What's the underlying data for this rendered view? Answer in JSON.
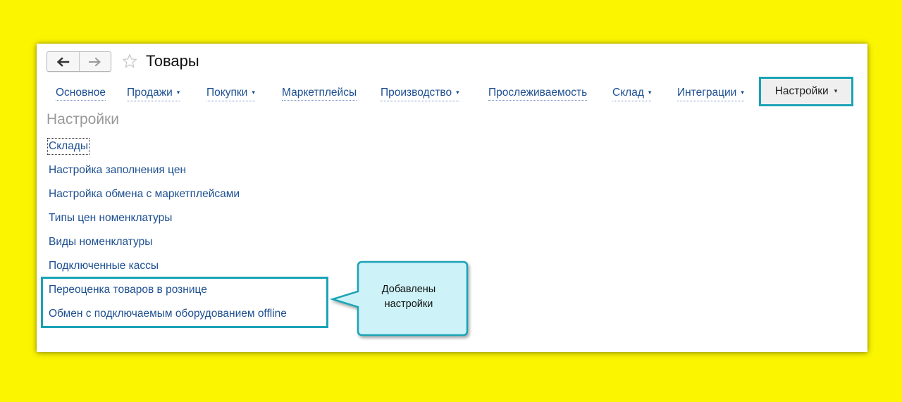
{
  "colors": {
    "background": "#fbf500",
    "link": "#1d4f91",
    "highlight": "#1aa3b5",
    "callout_fill": "#cdf3f8"
  },
  "header": {
    "back_icon": "arrow-left-icon",
    "forward_icon": "arrow-right-icon",
    "favorite_icon": "star-icon",
    "title": "Товары"
  },
  "tabs": [
    {
      "label": "Основное",
      "dropdown": false
    },
    {
      "label": "Продажи",
      "dropdown": true
    },
    {
      "label": "Покупки",
      "dropdown": true
    },
    {
      "label": "Маркетплейсы",
      "dropdown": false
    },
    {
      "label": "Производство",
      "dropdown": true
    },
    {
      "label": "Прослеживаемость",
      "dropdown": false
    },
    {
      "label": "Склад",
      "dropdown": true
    },
    {
      "label": "Интеграции",
      "dropdown": true
    }
  ],
  "active_tab": {
    "label": "Настройки",
    "dropdown": true
  },
  "dropdown_caret": "▾",
  "section": {
    "title": "Настройки",
    "links": [
      "Склады",
      "Настройка заполнения цен",
      "Настройка обмена с маркетплейсами",
      "Типы цен номенклатуры",
      "Виды номенклатуры",
      "Подключенные кассы",
      "Переоценка товаров в рознице",
      "Обмен с подключаемым оборудованием offline"
    ]
  },
  "callout": {
    "line1": "Добавлены",
    "line2": "настройки"
  }
}
